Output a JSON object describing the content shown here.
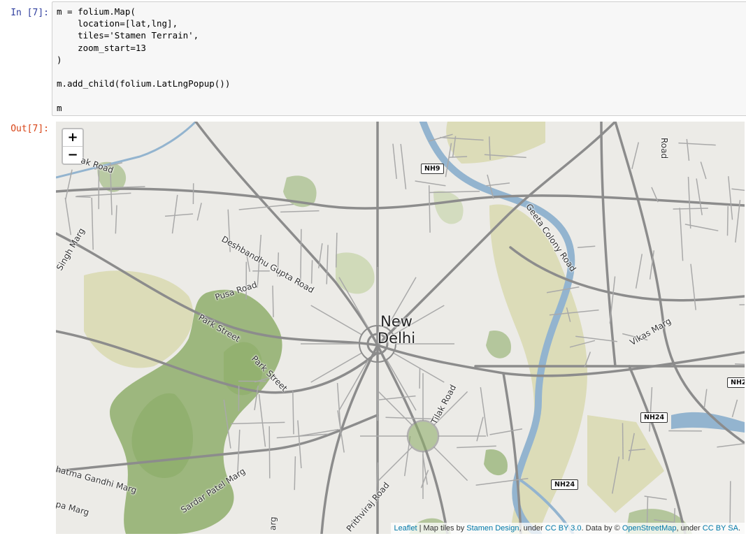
{
  "cell": {
    "in_prompt": "In [7]:",
    "out_prompt": "Out[7]:",
    "code_lines": [
      "m = folium.Map(",
      "    location=[lat,lng],",
      "    tiles='Stamen Terrain',",
      "    zoom_start=13",
      ")",
      "",
      "m.add_child(folium.LatLngPopup())",
      "",
      "m"
    ]
  },
  "map": {
    "zoom_in_label": "+",
    "zoom_out_label": "−",
    "city_label_line1": "New",
    "city_label_line2": "Delhi",
    "road_labels": {
      "deshbandhu": "Deshbandhu Gupta Road",
      "pusa": "Pusa Road",
      "park1": "Park Street",
      "park2": "Park Street",
      "geeta": "Geeta Colony Road",
      "vikas": "Vikas Marg",
      "tilak": "Tilak Road",
      "sardar": "Sardar Patel Marg",
      "gandhi": "hatma Gandhi Marg",
      "prithviraj": "Prithviraj Road",
      "singh": "Singh Marg",
      "rak": "ak Road",
      "road_top": "Road",
      "marg_bottom": "arg",
      "pa_marg": "pa Marg"
    },
    "shields": {
      "nh9": "NH9",
      "nh24_a": "NH24",
      "nh24_b": "NH24",
      "nh2": "NH2"
    },
    "attribution": {
      "leaflet": "Leaflet",
      "sep1": " | Map tiles by ",
      "stamen": "Stamen Design",
      "sep2": ", under ",
      "ccby": "CC BY 3.0",
      "sep3": ". Data by © ",
      "osm": "OpenStreetMap",
      "sep4": ", under ",
      "ccbysa": "CC BY SA",
      "end": "."
    },
    "colors": {
      "land": "#ecebe7",
      "park": "#8fae6b",
      "park_light": "#c9d6ae",
      "open_land": "#dcdcb8",
      "river": "#93b4cf",
      "road": "#8c8c8c",
      "minor_road": "#a9a9a9"
    }
  }
}
